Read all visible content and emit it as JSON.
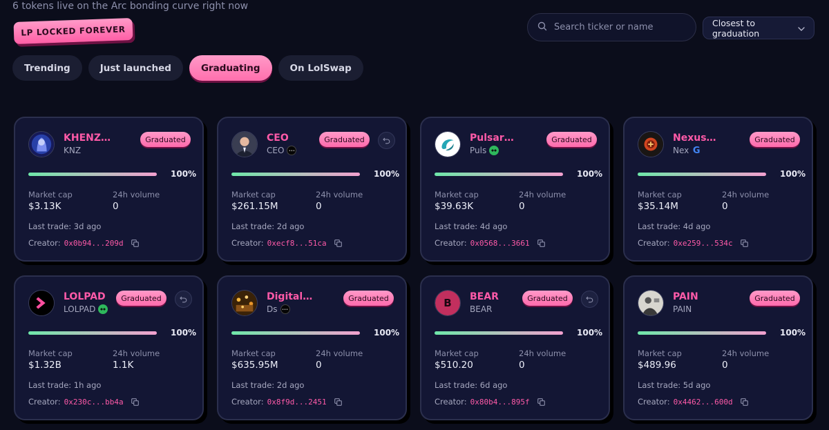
{
  "header": {
    "subtitle": "6 tokens live on the Arc bonding curve right now",
    "lp_badge": "LP LOCKED FOREVER"
  },
  "search": {
    "placeholder": "Search ticker or name",
    "icon": "search-icon"
  },
  "sort": {
    "selected": "Closest to graduation"
  },
  "tabs": [
    {
      "label": "Trending",
      "active": false
    },
    {
      "label": "Just launched",
      "active": false
    },
    {
      "label": "Graduating",
      "active": true
    },
    {
      "label": "On LolSwap",
      "active": false
    }
  ],
  "labels": {
    "graduated": "Graduated",
    "market_cap": "Market cap",
    "volume_24h": "24h volume",
    "creator": "Creator:"
  },
  "colors": {
    "accent": "#ff5aa8",
    "background": "#0b0d1b",
    "card": "#131634",
    "progress_start": "#6ee7a9",
    "progress_end": "#f3a0cf"
  },
  "tokens": [
    {
      "name": "KHENZAR",
      "ticker": "KNZ",
      "chain_icon": "",
      "progress": 100,
      "progress_label": "100%",
      "market_cap": "$3.13K",
      "volume_24h": "0",
      "last_trade": "Last trade: 3d ago",
      "creator": "0x0b94...209d",
      "has_revert": false,
      "avatar": "khenzar"
    },
    {
      "name": "CEO",
      "ticker": "CEO",
      "chain_icon": "dark",
      "progress": 100,
      "progress_label": "100%",
      "market_cap": "$261.15M",
      "volume_24h": "0",
      "last_trade": "Last trade: 2d ago",
      "creator": "0xecf8...51ca",
      "has_revert": true,
      "avatar": "ceo"
    },
    {
      "name": "Pulsarore",
      "ticker": "Puls",
      "chain_icon": "green",
      "progress": 100,
      "progress_label": "100%",
      "market_cap": "$39.63K",
      "volume_24h": "0",
      "last_trade": "Last trade: 4d ago",
      "creator": "0x0568...3661",
      "has_revert": false,
      "avatar": "pulsarore"
    },
    {
      "name": "NexusForge",
      "ticker": "Nex",
      "chain_icon": "google",
      "progress": 100,
      "progress_label": "100%",
      "market_cap": "$35.14M",
      "volume_24h": "0",
      "last_trade": "Last trade: 4d ago",
      "creator": "0xe259...534c",
      "has_revert": false,
      "avatar": "nexusforge"
    },
    {
      "name": "LOLPAD",
      "ticker": "LOLPAD",
      "chain_icon": "green",
      "progress": 100,
      "progress_label": "100%",
      "market_cap": "$1.32B",
      "volume_24h": "1.1K",
      "last_trade": "Last trade: 1h ago",
      "creator": "0x230c...bb4a",
      "has_revert": true,
      "avatar": "lolpad"
    },
    {
      "name": "DigitalS...",
      "ticker": "Ds",
      "chain_icon": "dark",
      "progress": 100,
      "progress_label": "100%",
      "market_cap": "$635.95M",
      "volume_24h": "0",
      "last_trade": "Last trade: 2d ago",
      "creator": "0x8f9d...2451",
      "has_revert": false,
      "avatar": "digitals"
    },
    {
      "name": "BEAR",
      "ticker": "BEAR",
      "chain_icon": "",
      "progress": 100,
      "progress_label": "100%",
      "market_cap": "$510.20",
      "volume_24h": "0",
      "last_trade": "Last trade: 6d ago",
      "creator": "0x80b4...895f",
      "has_revert": true,
      "avatar": "bear",
      "avatar_letter": "B"
    },
    {
      "name": "PAIN",
      "ticker": "PAIN",
      "chain_icon": "",
      "progress": 100,
      "progress_label": "100%",
      "market_cap": "$489.96",
      "volume_24h": "0",
      "last_trade": "Last trade: 5d ago",
      "creator": "0x4462...600d",
      "has_revert": false,
      "avatar": "pain"
    }
  ]
}
